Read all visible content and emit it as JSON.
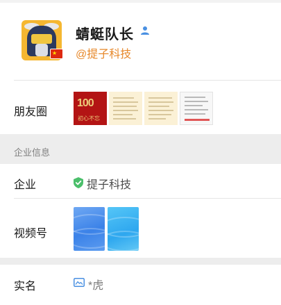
{
  "profile": {
    "name": "蜻蜓队长",
    "org_tag": "@提子科技",
    "avatar_icon": "masked-hero-avatar",
    "flag_icon": "china-flag-icon",
    "verified_icon": "person-icon"
  },
  "moments": {
    "label": "朋友圈",
    "thumbnails": [
      {
        "icon": "centenary-poster",
        "big_text": "100",
        "small_text": "初心不忘"
      },
      {
        "icon": "document-image"
      },
      {
        "icon": "document-image"
      },
      {
        "icon": "screenshot-image"
      }
    ]
  },
  "enterprise_section": {
    "header": "企业信息",
    "company_label": "企业",
    "company_value": "提子科技",
    "company_icon": "verified-shield-icon",
    "video_label": "视频号",
    "video_thumbnails": [
      {
        "icon": "video-cover-blue"
      },
      {
        "icon": "video-cover-cyan"
      }
    ]
  },
  "realname": {
    "label": "实名",
    "value": "*虎",
    "icon": "id-card-icon"
  },
  "colors": {
    "org_tag": "#e7882a",
    "shield": "#4bbf6b",
    "person_icon": "#4a90e2",
    "background": "#ededed"
  }
}
